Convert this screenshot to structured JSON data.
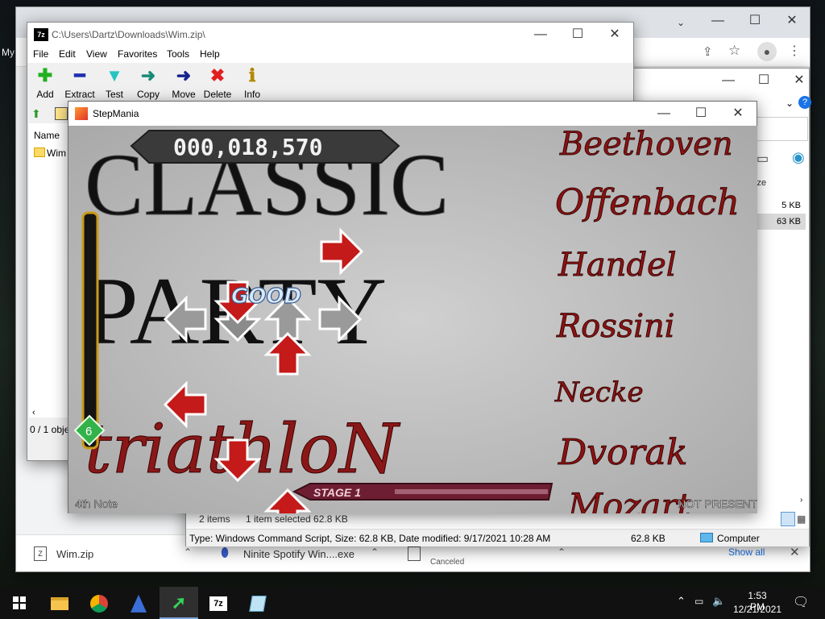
{
  "desktop": {
    "edge_text": "My"
  },
  "chrome": {
    "downloads": [
      {
        "name": "Wim.zip",
        "status": ""
      },
      {
        "name": "Ninite Spotify Win....exe",
        "status": ""
      },
      {
        "name": "",
        "status": "Canceled"
      }
    ],
    "show_all": "Show all"
  },
  "explorer": {
    "column_size": "ize",
    "file_sizes": [
      "5 KB",
      "63 KB"
    ],
    "status_items": "2 items",
    "status_selected": "1 item selected  62.8 KB",
    "details_text": "Type: Windows Command Script, Size: 62.8 KB, Date modified: 9/17/2021 10:28 AM",
    "details_size": "62.8 KB",
    "location": "Computer"
  },
  "sevenzip": {
    "app_icon": "7z",
    "title": "C:\\Users\\Dartz\\Downloads\\Wim.zip\\",
    "menu": [
      "File",
      "Edit",
      "View",
      "Favorites",
      "Tools",
      "Help"
    ],
    "toolbar": [
      {
        "label": "Add",
        "icon": "add-icon"
      },
      {
        "label": "Extract",
        "icon": "extract-icon"
      },
      {
        "label": "Test",
        "icon": "test-icon"
      },
      {
        "label": "Copy",
        "icon": "copy-icon"
      },
      {
        "label": "Move",
        "icon": "move-icon"
      },
      {
        "label": "Delete",
        "icon": "delete-icon"
      },
      {
        "label": "Info",
        "icon": "info-icon"
      }
    ],
    "column_name": "Name",
    "file_name": "Wim",
    "status": "0 / 1 obje"
  },
  "stepmania": {
    "title": "StepMania",
    "score": "000,018,570",
    "judgment": "GOOD",
    "combo": "6",
    "stage": "STAGE 1",
    "note_type": "4th Note",
    "player2": "NOT PRESENT",
    "banner": {
      "line1": "CLASSIC",
      "line2": "PARTY",
      "line3": "triathloN"
    },
    "composers": [
      "Beethoven",
      "Offenbach",
      "Handel",
      "Rossini",
      "Necke",
      "Dvorak",
      "Mozart"
    ]
  },
  "taskbar": {
    "time": "1:53 PM",
    "date": "12/21/2021",
    "apps": [
      "start",
      "file-explorer",
      "chrome",
      "edge-browser",
      "stepmania",
      "7zip",
      "notepad"
    ]
  }
}
